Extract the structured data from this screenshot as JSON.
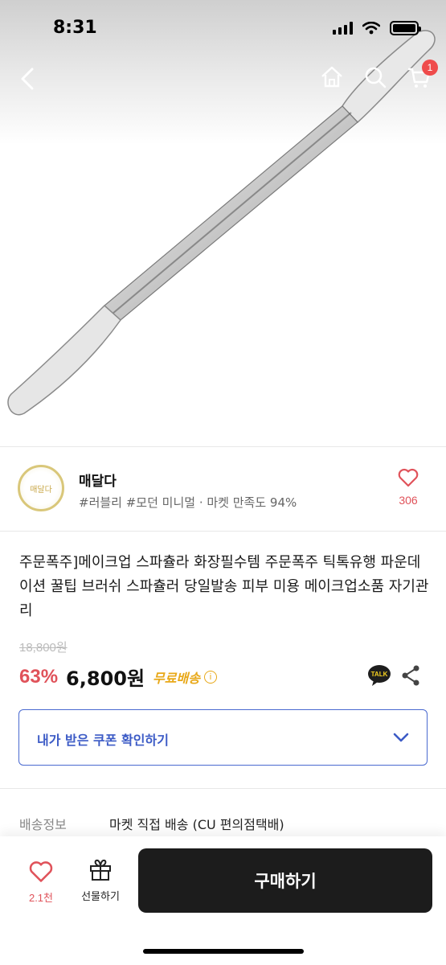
{
  "status_bar": {
    "time": "8:31"
  },
  "header": {
    "cart_badge": "1"
  },
  "seller": {
    "name": "매달다",
    "meta": "#러블리 #모던 미니멀 · 마켓 만족도 94%",
    "like_count": "306",
    "logo_text": "매달다"
  },
  "product": {
    "title": "주문폭주]메이크업 스파츌라 화장필수템 주문폭주 틱톡유행 파운데이션 꿀팁 브러쉬 스파츌러 당일발송 피부 미용 메이크업소품 자기관리",
    "original_price": "18,800원",
    "discount": "63%",
    "price": "6,800원",
    "free_shipping": "무료배송",
    "talk_label": "TALK"
  },
  "coupon": {
    "label": "내가 받은 쿠폰 확인하기"
  },
  "shipping": {
    "label": "배송정보",
    "value": "마켓 직접 배송 (CU 편의점택배)"
  },
  "bottom_bar": {
    "like_count": "2.1천",
    "gift_label": "선물하기",
    "buy_label": "구매하기"
  },
  "colors": {
    "accent_red": "#e0525a",
    "free_ship_orange": "#e8a818",
    "coupon_blue": "#3c5bc6",
    "buy_button": "#1c1c1c"
  }
}
